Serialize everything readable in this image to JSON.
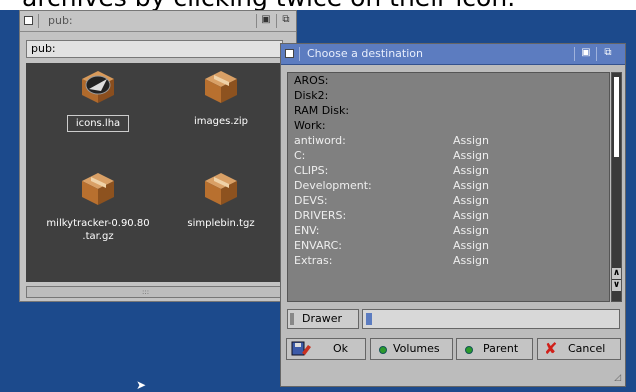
{
  "caption": "archives by clicking twice on their icon.",
  "pub_window": {
    "title": "pub:",
    "path": "pub:",
    "icons": [
      {
        "label": "icons.lha",
        "icon": "lha-archive-icon",
        "selected": true
      },
      {
        "label": "images.zip",
        "icon": "package-icon",
        "selected": false
      },
      {
        "label": "milkytracker-0.90.80\n.tar.gz",
        "icon": "package-icon",
        "selected": false
      },
      {
        "label": "simplebin.tgz",
        "icon": "package-icon",
        "selected": false
      }
    ]
  },
  "dialog": {
    "title": "Choose a destination",
    "volumes": [
      "AROS:",
      "Disk2:",
      "RAM Disk:",
      "Work:"
    ],
    "assigns": [
      {
        "name": "antiword:",
        "type": "Assign"
      },
      {
        "name": "C:",
        "type": "Assign"
      },
      {
        "name": "CLIPS:",
        "type": "Assign"
      },
      {
        "name": "Development:",
        "type": "Assign"
      },
      {
        "name": "DEVS:",
        "type": "Assign"
      },
      {
        "name": "DRIVERS:",
        "type": "Assign"
      },
      {
        "name": "ENV:",
        "type": "Assign"
      },
      {
        "name": "ENVARC:",
        "type": "Assign"
      },
      {
        "name": "Extras:",
        "type": "Assign"
      }
    ],
    "drawer_label": "Drawer",
    "drawer_value": "",
    "buttons": {
      "ok": "Ok",
      "volumes": "Volumes",
      "parent": "Parent",
      "cancel": "Cancel"
    },
    "colors": {
      "titlebar": "#5c7cc0",
      "list_bg": "#808080",
      "desktop": "#1c4a8c"
    }
  }
}
